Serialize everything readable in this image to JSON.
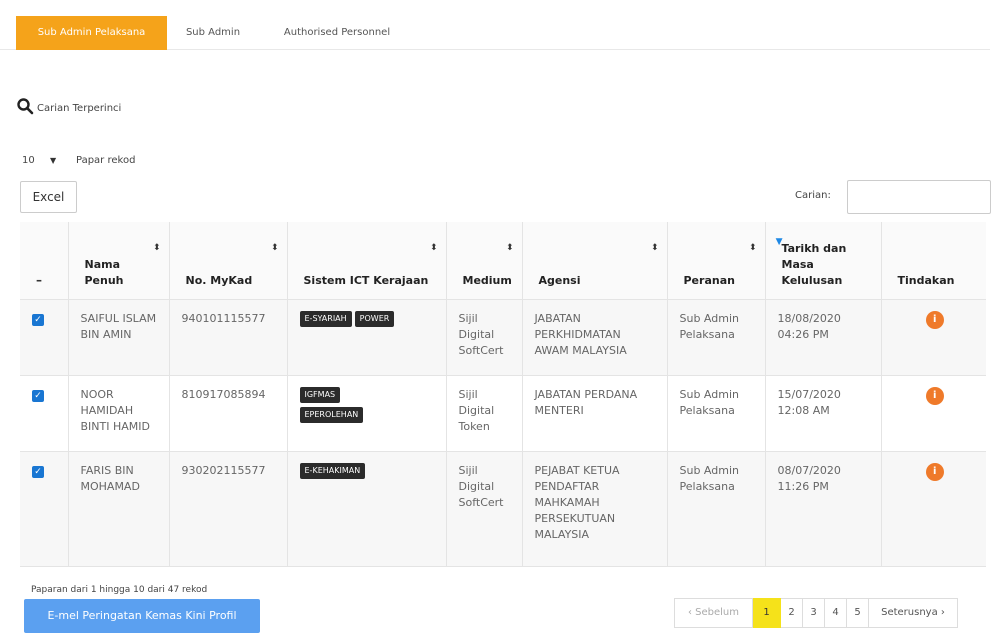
{
  "tabs": [
    {
      "label": "Sub Admin Pelaksana",
      "active": true
    },
    {
      "label": "Sub Admin",
      "active": false
    },
    {
      "label": "Authorised Personnel",
      "active": false
    }
  ],
  "advanced_search": {
    "icon": "search-icon",
    "label": "Carian Terperinci"
  },
  "page_length": {
    "value": "10",
    "label": "Papar rekod"
  },
  "excel_button": "Excel",
  "search": {
    "label": "Carian:",
    "value": ""
  },
  "table": {
    "columns": [
      {
        "label": "–"
      },
      {
        "label": "Nama Penuh"
      },
      {
        "label": "No. MyKad"
      },
      {
        "label": "Sistem ICT Kerajaan"
      },
      {
        "label": "Medium"
      },
      {
        "label": "Agensi"
      },
      {
        "label": "Peranan"
      },
      {
        "label": "Tarikh dan Masa Kelulusan"
      },
      {
        "label": "Tindakan"
      }
    ],
    "rows": [
      {
        "checked": true,
        "name": "SAIFUL ISLAM BIN AMIN",
        "mykad": "940101115577",
        "systems": [
          "E-SYARIAH",
          "POWER"
        ],
        "medium": "Sijil Digital SoftCert",
        "agency": "JABATAN PERKHIDMATAN AWAM MALAYSIA",
        "role": "Sub Admin Pelaksana",
        "date": "18/08/2020",
        "time": "04:26 PM",
        "action_icon": "info-icon"
      },
      {
        "checked": true,
        "name": "NOOR HAMIDAH BINTI HAMID",
        "mykad": "810917085894",
        "systems": [
          "IGFMAS",
          "EPEROLEHAN"
        ],
        "medium": "Sijil Digital Token",
        "agency": "JABATAN PERDANA MENTERI",
        "role": "Sub Admin Pelaksana",
        "date": "15/07/2020",
        "time": "12:08 AM",
        "action_icon": "info-icon"
      },
      {
        "checked": true,
        "name": "FARIS BIN MOHAMAD",
        "mykad": "930202115577",
        "systems": [
          "E-KEHAKIMAN"
        ],
        "medium": "Sijil Digital SoftCert",
        "agency": "PEJABAT KETUA PENDAFTAR MAHKAMAH PERSEKUTUAN MALAYSIA",
        "role": "Sub Admin Pelaksana",
        "date": "08/07/2020",
        "time": "11:26 PM",
        "action_icon": "info-icon"
      }
    ]
  },
  "info_text": "Paparan dari 1 hingga 10 dari 47 rekod",
  "email_button": "E-mel Peringatan Kemas Kini Profil",
  "pagination": {
    "prev": "‹ Sebelum",
    "pages": [
      "1",
      "2",
      "3",
      "4",
      "5"
    ],
    "current": "1",
    "next": "Seterusnya ›"
  },
  "colors": {
    "accent": "#f5a31a",
    "info": "#ef7a2a",
    "checkbox": "#1976d2",
    "email_button": "#5ba0f0",
    "current_page": "#f5e21a"
  }
}
